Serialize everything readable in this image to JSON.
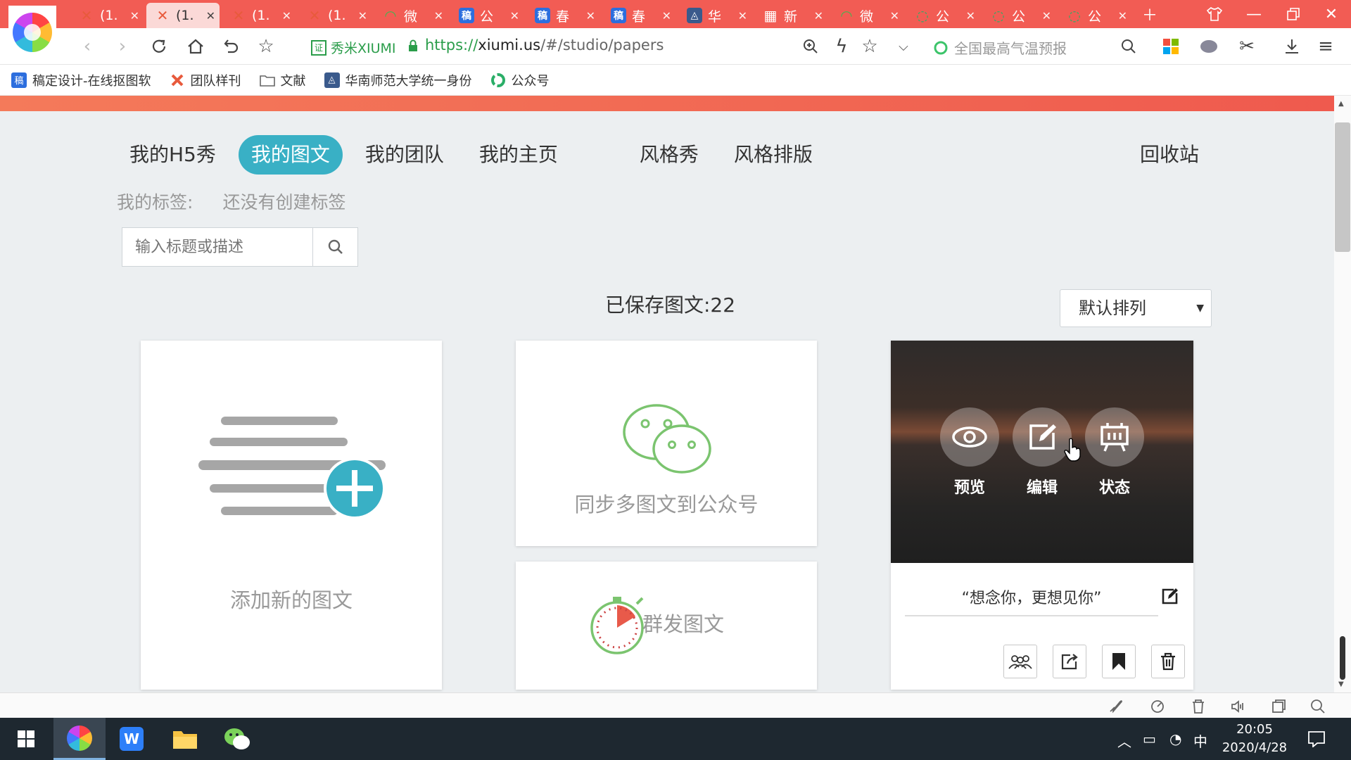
{
  "browser": {
    "tabs": [
      {
        "title": "(1.",
        "icon": "x-logo-icon",
        "color": "#e85a3c"
      },
      {
        "title": "(1.",
        "icon": "x-logo-icon",
        "color": "#e85a3c"
      },
      {
        "title": "(1.",
        "icon": "x-logo-icon",
        "color": "#e85a3c"
      },
      {
        "title": "(1.",
        "icon": "x-logo-icon",
        "color": "#e85a3c"
      },
      {
        "title": "微",
        "icon": "weibo-icon",
        "color": "#4cb050"
      },
      {
        "title": "公",
        "icon": "gaoding-icon",
        "color": "#2c6ede"
      },
      {
        "title": "春",
        "icon": "gaoding-icon",
        "color": "#2c6ede"
      },
      {
        "title": "春",
        "icon": "gaoding-icon",
        "color": "#2c6ede"
      },
      {
        "title": "华",
        "icon": "school-icon",
        "color": "#3a5a8c"
      },
      {
        "title": "新",
        "icon": "table-icon",
        "color": "#ffffff"
      },
      {
        "title": "微",
        "icon": "weibo-icon",
        "color": "#4cb050"
      },
      {
        "title": "公",
        "icon": "wechat-mp-icon",
        "color": "#2aae67"
      },
      {
        "title": "公",
        "icon": "wechat-mp-icon",
        "color": "#2aae67"
      },
      {
        "title": "公",
        "icon": "wechat-mp-icon",
        "color": "#2aae67"
      }
    ],
    "active_tab_index": 1,
    "site_name": "秀米XIUMI",
    "url_protocol": "https://",
    "url_host": "xiumi.us",
    "url_path": "/#/studio/papers",
    "search_placeholder": "全国最高气温预报",
    "bookmarks": [
      {
        "label": "稿定设计-在线抠图软",
        "icon": "gaoding-icon"
      },
      {
        "label": "团队样刊",
        "icon": "x-logo-icon"
      },
      {
        "label": "文献",
        "icon": "folder-icon"
      },
      {
        "label": "华南师范大学统一身份",
        "icon": "school-icon"
      },
      {
        "label": "公众号",
        "icon": "wechat-mp-icon"
      }
    ]
  },
  "page": {
    "nav": {
      "items": [
        "我的H5秀",
        "我的图文",
        "我的团队",
        "我的主页",
        "风格秀",
        "风格排版"
      ],
      "active_index": 1,
      "recycle": "回收站"
    },
    "tags_label": "我的标签:",
    "tags_empty": "还没有创建标签",
    "search_placeholder": "输入标题或描述",
    "saved_count": "已保存图文:22",
    "sort_value": "默认排列",
    "add_card_label": "添加新的图文",
    "sync_card_label": "同步多图文到公众号",
    "mass_card_label": "群发图文",
    "article": {
      "title": "“想念你，更想见你”",
      "overlay": {
        "preview": "预览",
        "edit": "编辑",
        "status": "状态"
      }
    },
    "accent_color": "#39b0c5"
  },
  "taskbar": {
    "time": "20:05",
    "date": "2020/4/28",
    "ime": "中"
  }
}
